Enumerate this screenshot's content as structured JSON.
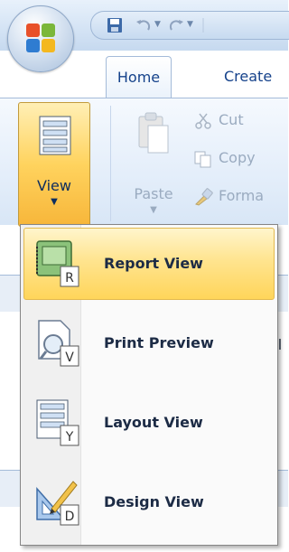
{
  "tabs": {
    "home": "Home",
    "create": "Create"
  },
  "ribbon": {
    "view_label": "View",
    "paste_label": "Paste",
    "cut_label": "Cut",
    "copy_label": "Copy",
    "format_label": "Forma"
  },
  "menu": {
    "items": [
      {
        "label": "Report View",
        "icon_letter": "R",
        "icon": "report-view-icon",
        "highlighted": true
      },
      {
        "label": "Print Preview",
        "icon_letter": "V",
        "icon": "print-preview-icon",
        "highlighted": false
      },
      {
        "label": "Layout View",
        "icon_letter": "Y",
        "icon": "layout-view-icon",
        "highlighted": false
      },
      {
        "label": "Design View",
        "icon_letter": "D",
        "icon": "design-view-icon",
        "highlighted": false
      }
    ]
  },
  "background": {
    "partial_text": "ol"
  },
  "colors": {
    "accent": "#ffd55a",
    "text": "#15428b"
  }
}
